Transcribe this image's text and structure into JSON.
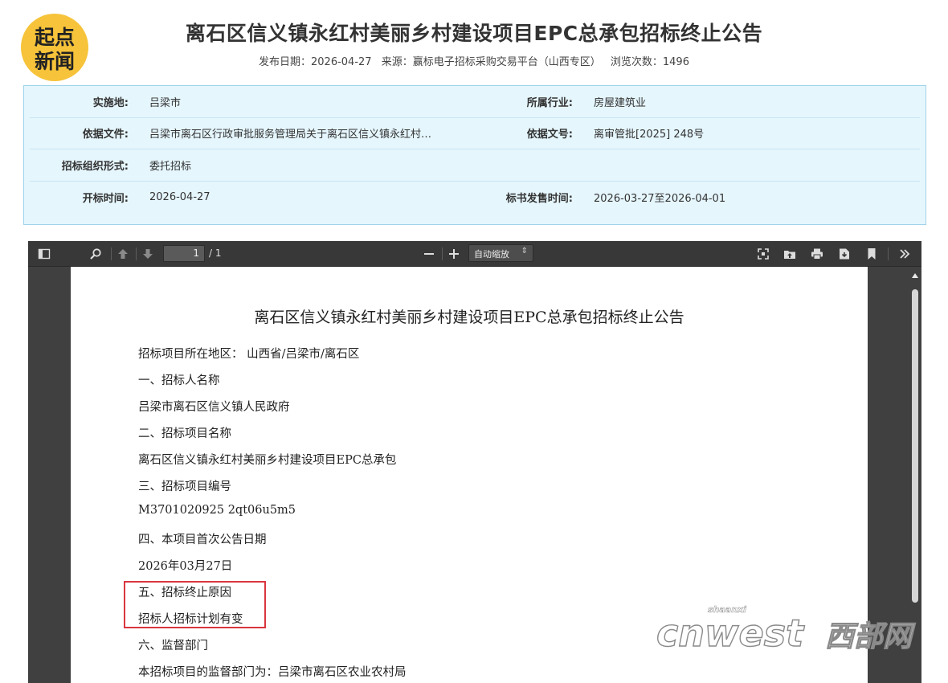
{
  "logo": {
    "line1": "起点",
    "line2": "新闻"
  },
  "header": {
    "title": "离石区信义镇永红村美丽乡村建设项目EPC总承包招标终止公告",
    "publish_date": "发布日期：2026-04-27",
    "source": "来源：赢标电子招标采购交易平台（山西专区）",
    "views": "浏览次数：1496"
  },
  "info": {
    "rows": [
      {
        "label1": "实施地:",
        "value1": "吕梁市",
        "label2": "所属行业:",
        "value2": "房屋建筑业"
      },
      {
        "label1": "依据文件:",
        "value1": "吕梁市离石区行政审批服务管理局关于离石区信义镇永红村…",
        "label2": "依据文号:",
        "value2": "离审管批[2025] 248号"
      },
      {
        "label1": "招标组织形式:",
        "value1": "委托招标",
        "label2": "",
        "value2": ""
      },
      {
        "label1": "开标时间:",
        "value1": "2026-04-27",
        "label2": "标书发售时间:",
        "value2": "2026-03-27至2026-04-01"
      }
    ]
  },
  "viewer": {
    "current_page": "1",
    "page_count": "/ 1",
    "zoom": "自动缩放",
    "document": {
      "title": "离石区信义镇永红村美丽乡村建设项目EPC总承包招标终止公告",
      "lines": [
        "招标项目所在地区：  山西省/吕梁市/离石区",
        "一、招标人名称",
        "吕梁市离石区信义镇人民政府",
        "二、招标项目名称",
        "离石区信义镇永红村美丽乡村建设项目EPC总承包",
        "三、招标项目编号",
        "M3701020925 2qt06u5m5",
        "四、本项目首次公告日期",
        "2026年03月27日",
        "五、招标终止原因",
        "招标人招标计划有变",
        "六、监督部门",
        "本招标项目的监督部门为：吕梁市离石区农业农村局"
      ]
    }
  },
  "watermark": {
    "brand": "cnwest",
    "sub": "shaanxi",
    "cn": "西部网"
  },
  "colors": {
    "info_bg": "#e5f6fd",
    "info_border": "#9fd3ea",
    "highlight": "#d9363e",
    "logo": "#f6c33a"
  }
}
